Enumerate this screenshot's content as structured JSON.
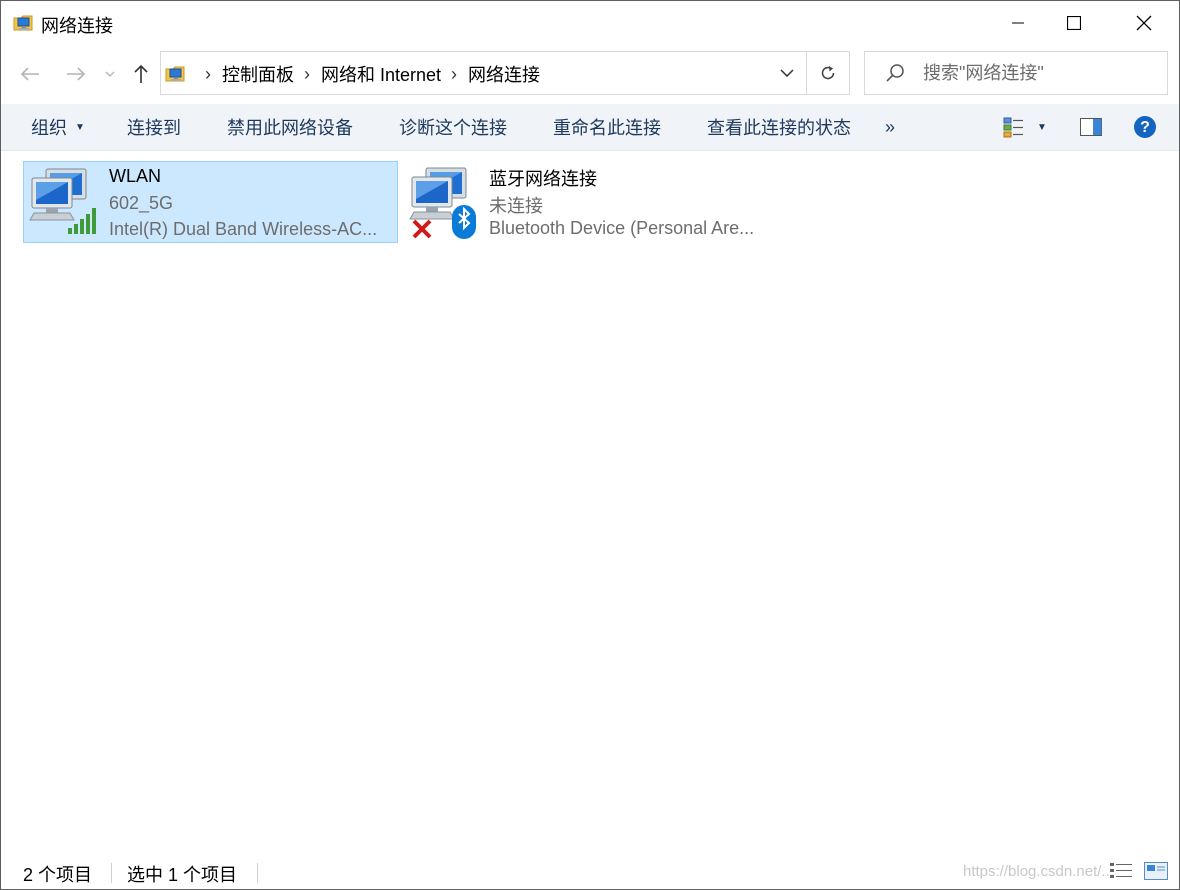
{
  "window": {
    "title": "网络连接",
    "controls": {
      "minimize": "minimize-icon",
      "maximize": "maximize-icon",
      "close": "close-icon"
    }
  },
  "nav": {
    "back": "arrow-left-icon",
    "forward": "arrow-right-icon",
    "recent": "chevron-down-icon",
    "up": "arrow-up-icon"
  },
  "address": {
    "icon": "network-folder-icon",
    "breadcrumbs": [
      {
        "label": "控制面板"
      },
      {
        "label": "网络和 Internet"
      },
      {
        "label": "网络连接"
      }
    ],
    "separator": "›",
    "refresh": "refresh-icon"
  },
  "search": {
    "placeholder": "搜索\"网络连接\""
  },
  "commands": {
    "organize": "组织",
    "connect_to": "连接到",
    "disable": "禁用此网络设备",
    "diagnose": "诊断这个连接",
    "rename": "重命名此连接",
    "view_status": "查看此连接的状态",
    "more": "»"
  },
  "items": [
    {
      "name": "WLAN",
      "status": "602_5G",
      "device": "Intel(R) Dual Band Wireless-AC...",
      "selected": true,
      "icon": "wifi-adapter-icon"
    },
    {
      "name": "蓝牙网络连接",
      "status": "未连接",
      "device": "Bluetooth Device (Personal Are...",
      "selected": false,
      "icon": "bluetooth-adapter-icon"
    }
  ],
  "statusbar": {
    "count": "2 个项目",
    "selected": "选中 1 个项目",
    "watermark": "https://blog.csdn.net/..."
  },
  "colors": {
    "accent": "#1e395b",
    "selection": "#cce8ff",
    "selection_border": "#99d1ff",
    "help": "#1565c0"
  }
}
